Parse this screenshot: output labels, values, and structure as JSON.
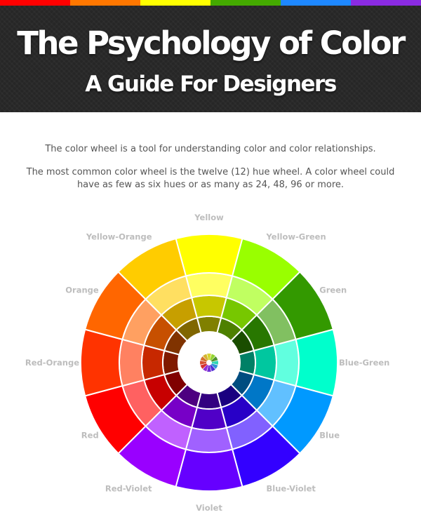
{
  "header": {
    "title": "The Psychology of Color",
    "subtitle": "A Guide For Designers",
    "stripe_colors": [
      "#ff0000",
      "#ff7700",
      "#ffff00",
      "#44aa00",
      "#1e88ff",
      "#8a2be2"
    ]
  },
  "intro": {
    "line1": "The color wheel is a tool for understanding color and color relationships.",
    "line2": "The most common color wheel is the twelve (12) hue wheel. A color wheel could have as few as six hues or as many as 24, 48, 96 or more."
  },
  "wheel": {
    "hues": [
      {
        "name": "Yellow",
        "color": "#ffff00"
      },
      {
        "name": "Yellow-Green",
        "color": "#99ff00"
      },
      {
        "name": "Green",
        "color": "#339900"
      },
      {
        "name": "Blue-Green",
        "color": "#00ffcc"
      },
      {
        "name": "Blue",
        "color": "#0099ff"
      },
      {
        "name": "Blue-Violet",
        "color": "#3300ff"
      },
      {
        "name": "Violet",
        "color": "#6600ff"
      },
      {
        "name": "Red-Violet",
        "color": "#9900ff"
      },
      {
        "name": "Red",
        "color": "#ff0000"
      },
      {
        "name": "Red-Orange",
        "color": "#ff3300"
      },
      {
        "name": "Orange",
        "color": "#ff6600"
      },
      {
        "name": "Yellow-Orange",
        "color": "#ffcc00"
      }
    ]
  }
}
